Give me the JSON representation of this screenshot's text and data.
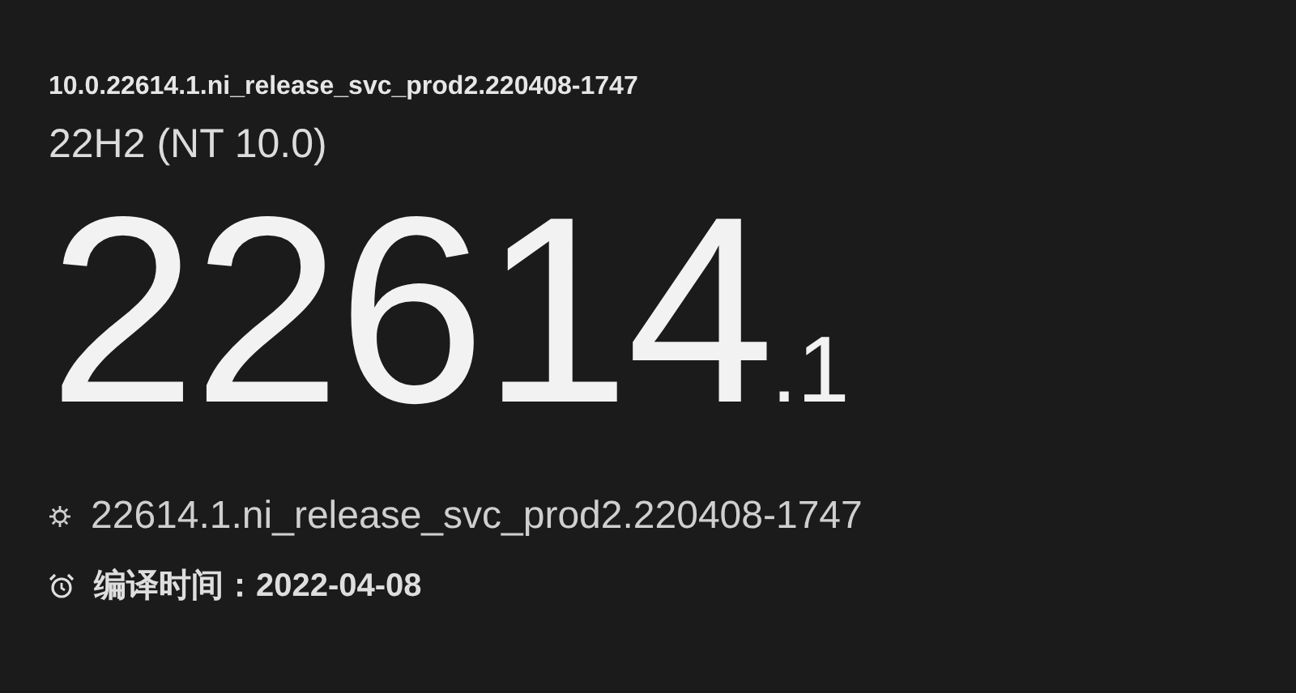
{
  "full_build": "10.0.22614.1.ni_release_svc_prod2.220408-1747",
  "version": "22H2 (NT 10.0)",
  "build_number": "22614",
  "revision": ".1",
  "branch": "22614.1.ni_release_svc_prod2.220408-1747",
  "compile_time": "编译时间：2022-04-08"
}
